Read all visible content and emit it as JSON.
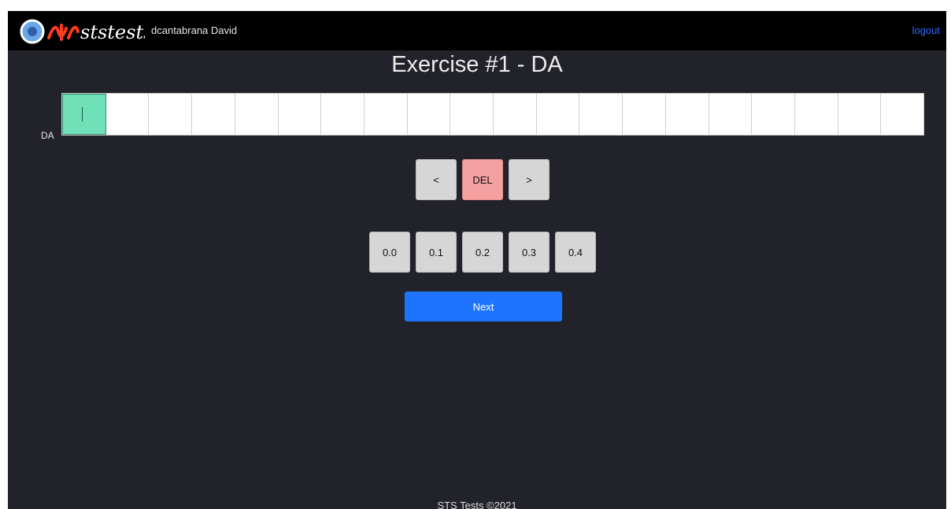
{
  "header": {
    "logo_text": "ststests",
    "username": "dcantabrana David",
    "logout_label": "logout"
  },
  "main": {
    "title": "Exercise #1 - DA",
    "row_label": "DA",
    "cells": [
      "",
      "",
      "",
      "",
      "",
      "",
      "",
      "",
      "",
      "",
      "",
      "",
      "",
      "",
      "",
      "",
      "",
      "",
      "",
      ""
    ],
    "active_cell_index": 0,
    "nav_buttons": {
      "prev_label": "<",
      "delete_label": "DEL",
      "next_label": ">"
    },
    "values": [
      "0.0",
      "0.1",
      "0.2",
      "0.3",
      "0.4"
    ],
    "next_button_label": "Next"
  },
  "footer": {
    "text": "STS Tests ©2021"
  },
  "colors": {
    "background": "#22232a",
    "topbar": "#000000",
    "active_cell": "#6fe0b8",
    "delete_button": "#f4a0a0",
    "next_button": "#1f74ff",
    "logout_link": "#2d6cff"
  }
}
